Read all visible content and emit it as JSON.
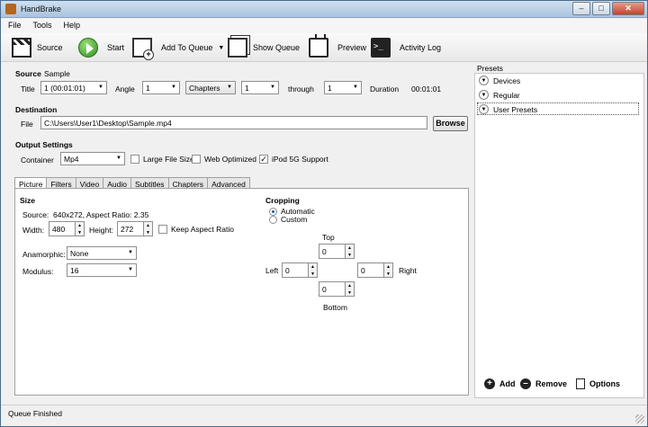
{
  "window": {
    "title": "HandBrake"
  },
  "menu": [
    "File",
    "Tools",
    "Help"
  ],
  "toolbar": {
    "source": "Source",
    "start": "Start",
    "add_to_queue": "Add To Queue",
    "show_queue": "Show Queue",
    "preview": "Preview",
    "activity_log": "Activity Log"
  },
  "source": {
    "label": "Source",
    "name": "Sample",
    "title_label": "Title",
    "title_value": "1 (00:01:01)",
    "angle_label": "Angle",
    "angle_value": "1",
    "range_mode": "Chapters",
    "range_start": "1",
    "through_label": "through",
    "range_end": "1",
    "duration_label": "Duration",
    "duration_value": "00:01:01"
  },
  "destination": {
    "label": "Destination",
    "file_label": "File",
    "file_path": "C:\\Users\\User1\\Desktop\\Sample.mp4",
    "browse": "Browse"
  },
  "output": {
    "label": "Output Settings",
    "container_label": "Container",
    "container_value": "Mp4",
    "large_file": "Large File Size",
    "large_file_checked": false,
    "web_optimized": "Web Optimized",
    "web_optimized_checked": false,
    "ipod": "iPod 5G Support",
    "ipod_checked": true
  },
  "tabs": [
    "Picture",
    "Filters",
    "Video",
    "Audio",
    "Subtitles",
    "Chapters",
    "Advanced"
  ],
  "active_tab": "Picture",
  "picture": {
    "size_label": "Size",
    "source_label": "Source:",
    "source_value": "640x272, Aspect Ratio: 2.35",
    "width_label": "Width:",
    "width_value": "480",
    "height_label": "Height:",
    "height_value": "272",
    "keep_aspect": "Keep Aspect Ratio",
    "keep_aspect_checked": false,
    "anamorphic_label": "Anamorphic:",
    "anamorphic_value": "None",
    "modulus_label": "Modulus:",
    "modulus_value": "16",
    "cropping_label": "Cropping",
    "automatic": "Automatic",
    "custom": "Custom",
    "crop_mode": "Automatic",
    "top_label": "Top",
    "top_value": "0",
    "left_label": "Left",
    "left_value": "0",
    "right_label": "Right",
    "right_value": "0",
    "bottom_label": "Bottom",
    "bottom_value": "0"
  },
  "presets": {
    "label": "Presets",
    "items": [
      "Devices",
      "Regular",
      "User Presets"
    ],
    "add": "Add",
    "remove": "Remove",
    "options": "Options"
  },
  "status": "Queue Finished"
}
